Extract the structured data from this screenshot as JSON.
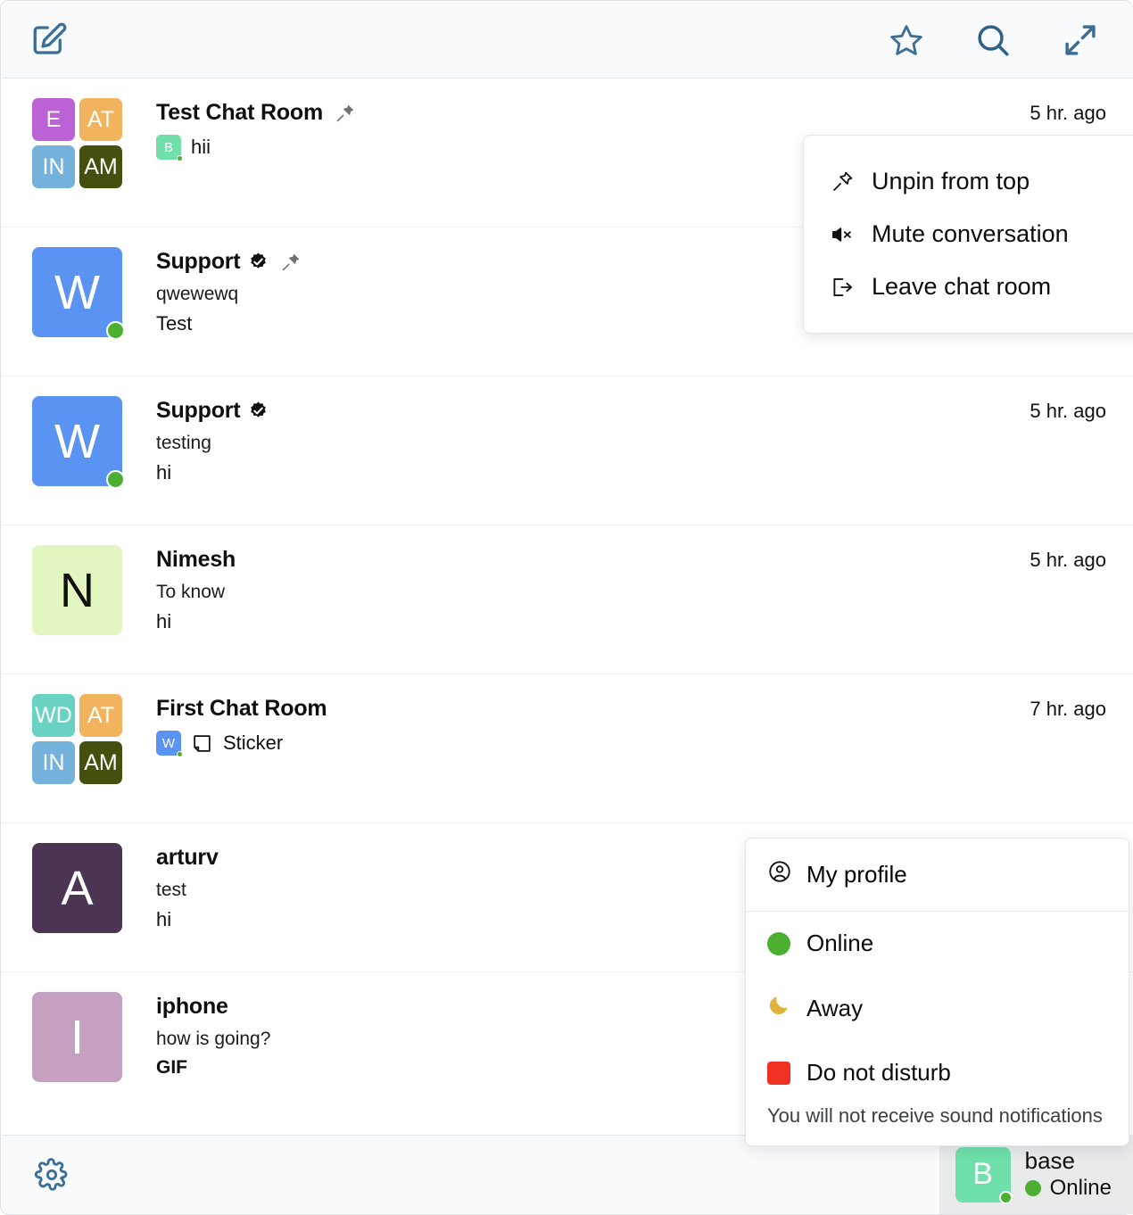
{
  "header": {
    "compose_icon": "compose-edit-icon",
    "actions": [
      {
        "name": "favorites-star-icon",
        "label": "Favorites"
      },
      {
        "name": "search-icon",
        "label": "Search"
      },
      {
        "name": "expand-icon",
        "label": "Expand"
      }
    ]
  },
  "chats": [
    {
      "id": "test-chat-room",
      "title": "Test Chat Room",
      "pinned": true,
      "verified": false,
      "time": "5 hr. ago",
      "subtitle": "",
      "preview": "hii",
      "preview_bold": false,
      "preview_sender_initial": "B",
      "preview_sender_color": "#6fe0ab",
      "avatar_type": "grid",
      "avatar_cells": [
        {
          "label": "E",
          "color": "#bb62d6"
        },
        {
          "label": "AT",
          "color": "#f2b35e"
        },
        {
          "label": "IN",
          "color": "#74b2dc"
        },
        {
          "label": "AM",
          "color": "#45500f"
        }
      ]
    },
    {
      "id": "support-qwewewq",
      "title": "Support",
      "pinned": true,
      "verified": true,
      "time": "",
      "subtitle": "qwewewq",
      "preview": "Test",
      "preview_bold": false,
      "avatar_type": "letter",
      "avatar_letter": "W",
      "avatar_color": "#5b93f2",
      "online": true
    },
    {
      "id": "support-testing",
      "title": "Support",
      "pinned": false,
      "verified": true,
      "time": "5 hr. ago",
      "subtitle": "testing",
      "preview": "hi",
      "preview_bold": false,
      "avatar_type": "letter",
      "avatar_letter": "W",
      "avatar_color": "#5b93f2",
      "online": true
    },
    {
      "id": "nimesh",
      "title": "Nimesh",
      "pinned": false,
      "verified": false,
      "time": "5 hr. ago",
      "subtitle": "To know",
      "preview": "hi",
      "preview_bold": false,
      "avatar_type": "letter",
      "avatar_letter": "N",
      "avatar_color": "#e3f5c0",
      "avatar_dark_text": true
    },
    {
      "id": "first-chat-room",
      "title": "First Chat Room",
      "pinned": false,
      "verified": false,
      "time": "7 hr. ago",
      "subtitle": "",
      "preview": "Sticker",
      "preview_icon": "sticker-icon",
      "preview_bold": false,
      "preview_sender_initial": "W",
      "preview_sender_color": "#5b93f2",
      "avatar_type": "grid",
      "avatar_cells": [
        {
          "label": "WD",
          "color": "#69d2c2"
        },
        {
          "label": "AT",
          "color": "#f2b35e"
        },
        {
          "label": "IN",
          "color": "#74b2dc"
        },
        {
          "label": "AM",
          "color": "#45500f"
        }
      ]
    },
    {
      "id": "arturv",
      "title": "arturv",
      "pinned": false,
      "verified": false,
      "time": "",
      "subtitle": "test",
      "preview": "hi",
      "preview_bold": false,
      "avatar_type": "letter",
      "avatar_letter": "A",
      "avatar_color": "#4b3552"
    },
    {
      "id": "iphone",
      "title": "iphone",
      "pinned": false,
      "verified": false,
      "time": "",
      "subtitle": "how is going?",
      "preview": "GIF",
      "preview_bold": true,
      "avatar_type": "letter",
      "avatar_letter": "I",
      "avatar_color": "#c4a0c1"
    }
  ],
  "context_menu": {
    "items": [
      {
        "icon": "unpin-icon",
        "label": "Unpin from top"
      },
      {
        "icon": "mute-icon",
        "label": "Mute conversation"
      },
      {
        "icon": "leave-icon",
        "label": "Leave chat room"
      }
    ]
  },
  "status_menu": {
    "profile": {
      "icon": "user-circle-icon",
      "label": "My profile"
    },
    "options": [
      {
        "icon": "green-circle",
        "label": "Online",
        "color": "#4caf32"
      },
      {
        "icon": "moon-icon",
        "label": "Away",
        "color": "#e0b33a"
      },
      {
        "icon": "red-square",
        "label": "Do not disturb",
        "color": "#ef3124"
      }
    ],
    "hint": "You will not receive sound notifications"
  },
  "footer": {
    "settings_icon": "gear-icon",
    "user": {
      "avatar_letter": "B",
      "avatar_color": "#6fe0ab",
      "name": "base",
      "status": "Online",
      "status_color": "#4caf32"
    }
  }
}
